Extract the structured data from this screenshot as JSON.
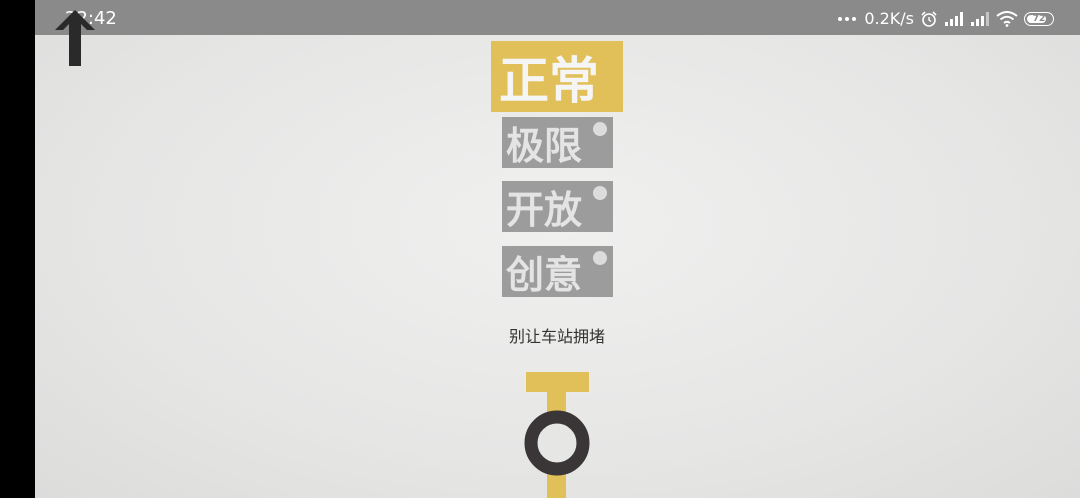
{
  "status_bar": {
    "time": "22:42",
    "net_speed": "0.2K/s",
    "battery": "72",
    "icons": [
      "more-dots-icon",
      "alarm-icon",
      "signal-icon",
      "signal-icon",
      "wifi-icon",
      "battery-icon"
    ]
  },
  "back_icon": "arrow-up-icon",
  "modes": {
    "normal": "正常",
    "extreme": "极限",
    "open": "开放",
    "create": "创意"
  },
  "tagline": "别让车站拥堵",
  "colors": {
    "accent": "#e1c05a",
    "locked": "#9c9c9c",
    "station": "#3a3536",
    "background": "#ebebea"
  }
}
